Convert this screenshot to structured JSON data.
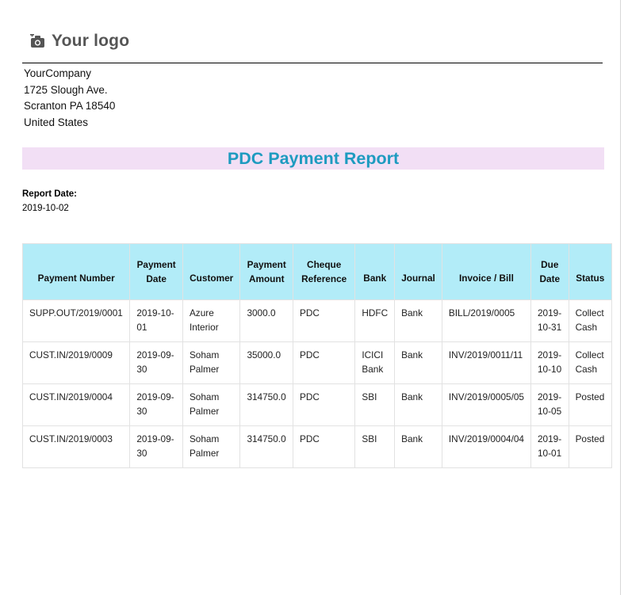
{
  "logo": {
    "icon": "camera-icon",
    "text": "Your logo"
  },
  "company": {
    "name": "YourCompany",
    "street": "1725 Slough Ave.",
    "city": "Scranton PA 18540",
    "country": "United States"
  },
  "report": {
    "title": "PDC Payment Report",
    "date_label": "Report Date:",
    "date_value": "2019-10-02"
  },
  "colors": {
    "title": "#1e9bc0",
    "title_band": "#f2dff5",
    "table_header": "#b2ecf8"
  },
  "table": {
    "headers": {
      "payment_number": "Payment Number",
      "payment_date_1": "Payment",
      "payment_date_2": "Date",
      "customer": "Customer",
      "amount_1": "Payment",
      "amount_2": "Amount",
      "cheque_1": "Cheque",
      "cheque_2": "Reference",
      "bank": "Bank",
      "journal": "Journal",
      "invoice": "Invoice / Bill",
      "due_1": "Due",
      "due_2": "Date",
      "status": "Status"
    },
    "rows": [
      {
        "number": "SUPP.OUT/2019/0001",
        "date_1": "2019-10-",
        "date_2": "01",
        "customer_1": "Azure",
        "customer_2": "Interior",
        "amount": "3000.0",
        "cheque": "PDC",
        "bank_1": "HDFC",
        "bank_2": "",
        "journal": "Bank",
        "invoice": "BILL/2019/0005",
        "due_1": "2019-",
        "due_2": "10-31",
        "status_1": "Collect",
        "status_2": "Cash"
      },
      {
        "number": "CUST.IN/2019/0009",
        "date_1": "2019-09-",
        "date_2": "30",
        "customer_1": "Soham",
        "customer_2": "Palmer",
        "amount": "35000.0",
        "cheque": "PDC",
        "bank_1": "ICICI",
        "bank_2": "Bank",
        "journal": "Bank",
        "invoice": "INV/2019/0011/11",
        "due_1": "2019-",
        "due_2": "10-10",
        "status_1": "Collect",
        "status_2": "Cash"
      },
      {
        "number": "CUST.IN/2019/0004",
        "date_1": "2019-09-",
        "date_2": "30",
        "customer_1": "Soham",
        "customer_2": "Palmer",
        "amount": "314750.0",
        "cheque": "PDC",
        "bank_1": "SBI",
        "bank_2": "",
        "journal": "Bank",
        "invoice": "INV/2019/0005/05",
        "due_1": "2019-",
        "due_2": "10-05",
        "status_1": "Posted",
        "status_2": ""
      },
      {
        "number": "CUST.IN/2019/0003",
        "date_1": "2019-09-",
        "date_2": "30",
        "customer_1": "Soham",
        "customer_2": "Palmer",
        "amount": "314750.0",
        "cheque": "PDC",
        "bank_1": "SBI",
        "bank_2": "",
        "journal": "Bank",
        "invoice": "INV/2019/0004/04",
        "due_1": "2019-",
        "due_2": "10-01",
        "status_1": "Posted",
        "status_2": ""
      }
    ]
  }
}
